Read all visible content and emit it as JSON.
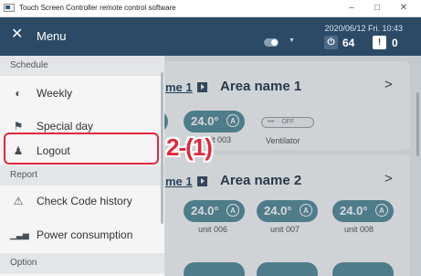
{
  "window": {
    "title": "Touch Screen Controller remote control software",
    "minimize": "–",
    "maximize": "□",
    "close": "✕"
  },
  "topbar": {
    "datetime": "2020/06/12 Fri. 10:43",
    "stats": [
      {
        "icon": "power-icon",
        "symbol": "⏻",
        "count": "64",
        "color": "#ffffff",
        "bg": "#4d6a85"
      },
      {
        "icon": "warning-icon",
        "symbol": "!",
        "count": "0",
        "color": "#2c4a66",
        "bg": "#ffffff"
      }
    ]
  },
  "menu": {
    "close_glyph": "✕",
    "title": "Menu",
    "sections": [
      {
        "header": "Schedule",
        "items": [
          {
            "label": "Weekly",
            "icon": "weekly-schedule-icon",
            "glyph": "◐"
          },
          {
            "label": "Special day",
            "icon": "flag-icon",
            "glyph": "⚑"
          },
          {
            "label": "Logout",
            "icon": "person-icon",
            "glyph": "♟"
          }
        ]
      },
      {
        "header": "Report",
        "items": [
          {
            "label": "Check Code history",
            "icon": "alert-history-icon",
            "glyph": "⚠"
          },
          {
            "label": "Power consumption",
            "icon": "power-consumption-icon",
            "glyph": "▁▃▅"
          }
        ]
      },
      {
        "header": "Option",
        "items": []
      }
    ]
  },
  "annotation": "2-(1)",
  "areas": [
    {
      "link": "me 1",
      "name": "Area name 1",
      "chevron": ">",
      "temps": [
        {
          "value": "24.0°",
          "unit": "unit 003",
          "mode": "A"
        }
      ],
      "ventilator": {
        "state": "OFF",
        "dots": "•••",
        "label": "Ventilator"
      }
    },
    {
      "link": "me 1",
      "name": "Area name 2",
      "chevron": ">",
      "temps": [
        {
          "value": "24.0°",
          "unit": "unit 006",
          "mode": "A"
        },
        {
          "value": "24.0°",
          "unit": "unit 007",
          "mode": "A"
        },
        {
          "value": "24.0°",
          "unit": "unit 008",
          "mode": "A"
        }
      ]
    }
  ]
}
